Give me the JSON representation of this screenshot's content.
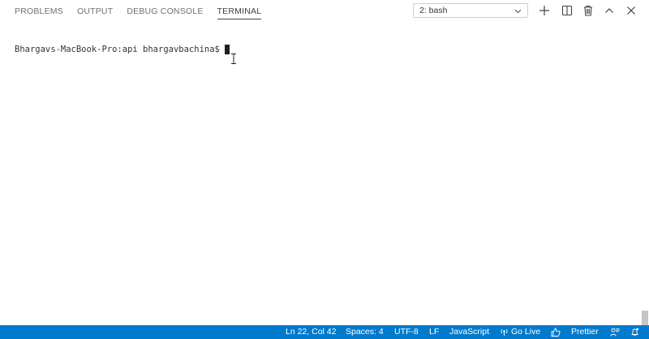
{
  "panel": {
    "tabs": [
      {
        "label": "PROBLEMS"
      },
      {
        "label": "OUTPUT"
      },
      {
        "label": "DEBUG CONSOLE"
      },
      {
        "label": "TERMINAL",
        "active": true
      }
    ],
    "terminal_select": {
      "value": "2: bash"
    },
    "actions": {
      "new_terminal": "plus-icon",
      "split_terminal": "split-icon",
      "kill_terminal": "trash-icon",
      "maximize_panel": "chevron-up-icon",
      "close_panel": "close-icon"
    }
  },
  "terminal": {
    "prompt": "Bhargavs-MacBook-Pro:api bhargavbachina$"
  },
  "statusbar": {
    "background": "#007acc",
    "position": "Ln 22, Col 42",
    "indent": "Spaces: 4",
    "encoding": "UTF-8",
    "eol": "LF",
    "language": "JavaScript",
    "go_live": "Go Live",
    "prettier": "Prettier"
  }
}
